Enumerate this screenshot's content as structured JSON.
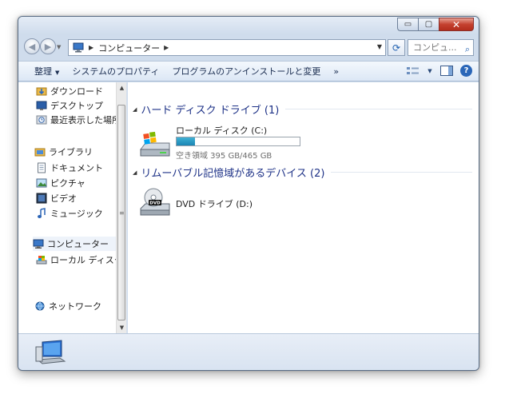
{
  "window": {
    "caption": {
      "minimize": "▭",
      "maximize": "▢",
      "close": "✕"
    }
  },
  "address": {
    "location_icon": "computer-icon",
    "path": [
      "コンピューター"
    ],
    "search_placeholder": "コンピュ..."
  },
  "commandbar": {
    "organize": "整理",
    "system_properties": "システムのプロパティ",
    "uninstall": "プログラムのアンインストールと変更",
    "more": "»"
  },
  "nav": {
    "items": [
      {
        "label": "ダウンロード",
        "icon": "downloads-folder-icon"
      },
      {
        "label": "デスクトップ",
        "icon": "desktop-icon"
      },
      {
        "label": "最近表示した場所",
        "icon": "recent-places-icon"
      },
      {
        "label": "ライブラリ",
        "icon": "libraries-icon"
      },
      {
        "label": "ドキュメント",
        "icon": "documents-icon"
      },
      {
        "label": "ピクチャ",
        "icon": "pictures-icon"
      },
      {
        "label": "ビデオ",
        "icon": "videos-icon"
      },
      {
        "label": "ミュージック",
        "icon": "music-icon"
      },
      {
        "label": "コンピューター",
        "icon": "computer-icon"
      },
      {
        "label": "ローカル ディスク (C:)",
        "icon": "local-disk-icon"
      },
      {
        "label": "ネットワーク",
        "icon": "network-icon"
      }
    ]
  },
  "content": {
    "groups": [
      {
        "title": "ハード ディスク ドライブ (1)",
        "drives": [
          {
            "name": "ローカル ディスク (C:)",
            "free_text": "空き領域 395 GB/465 GB",
            "used_fraction": 0.15,
            "icon": "hard-drive-icon"
          }
        ]
      },
      {
        "title": "リムーバブル記憶域があるデバイス (2)",
        "drives": [
          {
            "name": "DVD ドライブ (D:)",
            "icon": "dvd-drive-icon"
          }
        ]
      }
    ]
  },
  "details": {
    "icon": "computer-icon"
  },
  "colors": {
    "accent": "#1e3287",
    "usage_bar": "#1a85b3",
    "close_button": "#c4412f"
  }
}
